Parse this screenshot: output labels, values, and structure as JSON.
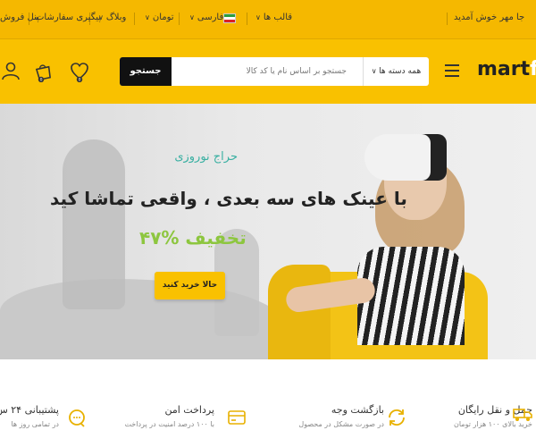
{
  "topbar": {
    "welcome": "ی میتوانید ویژگیهای این وب سایت را تجربه کنید ... به فروشگاه مارت فروش خوش آمدید",
    "welcome_visible": "جا مهر خوش آمدید",
    "templates": "قالب ها",
    "language": "فارسی",
    "currency": "تومان",
    "blog": "وبلاگ",
    "track_orders": "پیگیری سفارشات",
    "seller_panel": "پنل فروش"
  },
  "header": {
    "logo_main": "mart",
    "logo_accent": "fu",
    "search_button": "جستجو",
    "search_placeholder": "جستجو بر اساس نام یا کد کالا",
    "category_select": "همه دسته ها",
    "compare_badge": "0",
    "cart_badge": "0",
    "wishlist_badge": "0"
  },
  "hero": {
    "kicker": "حراج نوروزی",
    "title": "با عینک های سه بعدی ، واقعی تماشا کید",
    "discount": "۴۷% تخفیف",
    "cta": "حالا خرید کنید"
  },
  "features": [
    {
      "title": "حمل و نقل رایگان",
      "subtitle": "خرید بالای ۱۰۰ هزار تومان"
    },
    {
      "title": "بازگشت وجه",
      "subtitle": "در صورت مشکل در محصول"
    },
    {
      "title": "پرداخت امن",
      "subtitle": "با ۱۰۰ درصد امنیت در پرداخت"
    },
    {
      "title": "پشتیبانی ۲۴ س",
      "subtitle": "در تمامی روز ها"
    }
  ],
  "colors": {
    "brand": "#f9c100",
    "accent_green": "#8dc63f",
    "accent_teal": "#3ab0a2",
    "feature_icon": "#e8b100"
  }
}
